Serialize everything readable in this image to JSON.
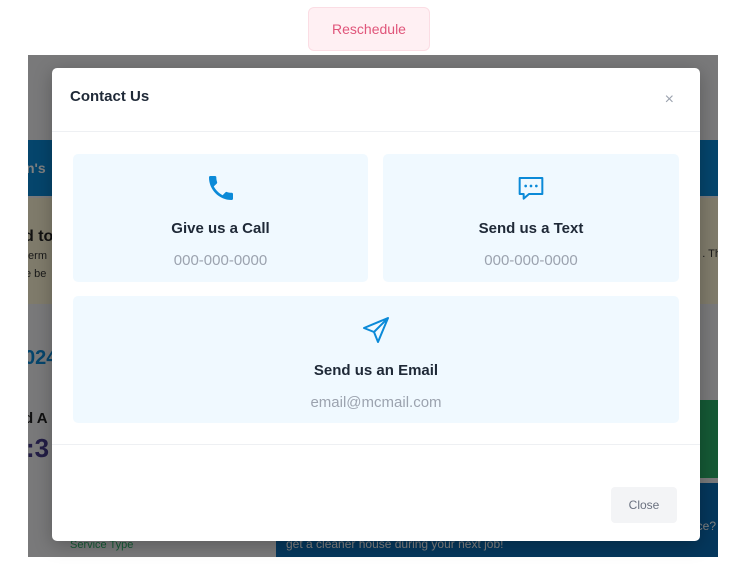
{
  "top": {
    "reschedule_label": "Reschedule"
  },
  "background": {
    "bar_text": "n's",
    "notice_title": "d to",
    "notice_line1": "term",
    "notice_line2": "e be",
    "notice_right": ". Th",
    "year_fragment": "024",
    "label_fragment": "d A",
    "time_fragment": ":3",
    "promo_question": "ce?",
    "promo_sub": "get a cleaner house during your next job!",
    "service_type": "Service Type"
  },
  "modal": {
    "title": "Contact Us",
    "close_icon": "×",
    "cards": {
      "call": {
        "title": "Give us a Call",
        "value": "000-000-0000",
        "icon": "phone-icon"
      },
      "text": {
        "title": "Send us a Text",
        "value": "000-000-0000",
        "icon": "chat-icon"
      },
      "email": {
        "title": "Send us an Email",
        "value": "email@mcmail.com",
        "icon": "send-icon"
      }
    },
    "close_button_label": "Close"
  },
  "colors": {
    "accent": "#0b8ad8",
    "card_bg": "#f0f9ff",
    "reschedule_text": "#e0557a"
  }
}
